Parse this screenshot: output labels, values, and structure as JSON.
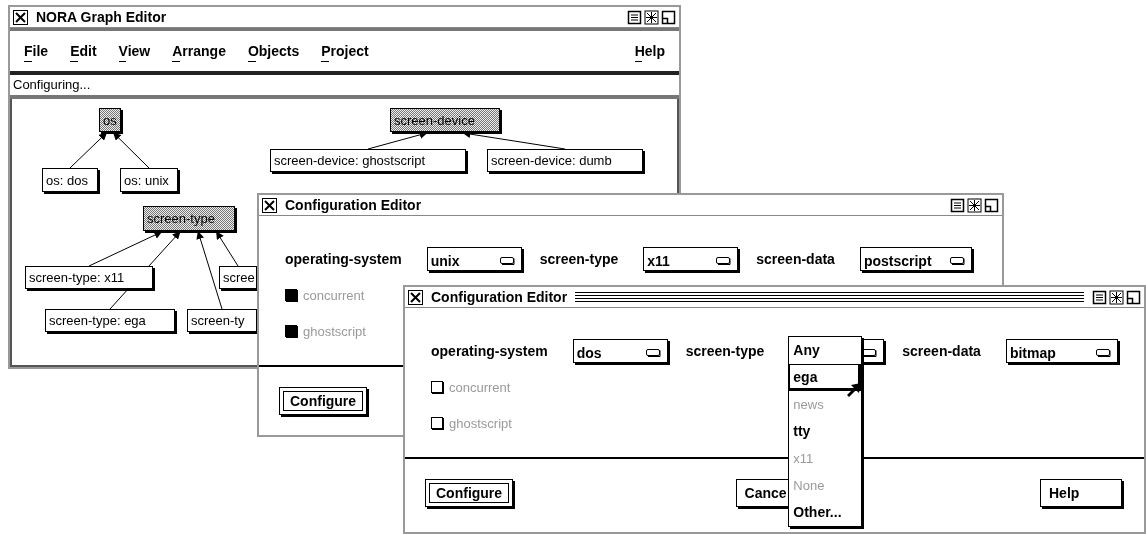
{
  "windows": [
    {
      "kind": "graph_editor",
      "title": "NORA Graph Editor",
      "active": false,
      "menus": [
        {
          "label": "File"
        },
        {
          "label": "Edit"
        },
        {
          "label": "View"
        },
        {
          "label": "Arrange"
        },
        {
          "label": "Objects"
        },
        {
          "label": "Project"
        }
      ],
      "help_menu": "Help",
      "status": "Configuring...",
      "graph": [
        {
          "label": "os",
          "kind": "class",
          "children": [
            {
              "label": "os: dos",
              "kind": "instance"
            },
            {
              "label": "os: unix",
              "kind": "instance"
            }
          ]
        },
        {
          "label": "screen-device",
          "kind": "class",
          "children": [
            {
              "label": "screen-device: ghostscript",
              "kind": "instance"
            },
            {
              "label": "screen-device: dumb",
              "kind": "instance"
            }
          ]
        },
        {
          "label": "screen-type",
          "kind": "class",
          "children": [
            {
              "label": "screen-type: x11",
              "kind": "instance"
            },
            {
              "label": "scree",
              "kind": "instance"
            },
            {
              "label": "screen-type: ega",
              "kind": "instance"
            },
            {
              "label": "screen-ty",
              "kind": "instance"
            }
          ]
        }
      ]
    },
    {
      "kind": "config_editor",
      "title": "Configuration Editor",
      "active": false,
      "fields": [
        {
          "label": "operating-system",
          "value": "unix",
          "expanded": false
        },
        {
          "label": "screen-type",
          "value": "x11",
          "expanded": false
        },
        {
          "label": "screen-data",
          "value": "postscript",
          "expanded": false
        }
      ],
      "options": [
        {
          "label": "concurrent",
          "checked": true,
          "disabled": true
        },
        {
          "label": "ghostscript",
          "checked": true,
          "disabled": true
        }
      ],
      "buttons": [
        {
          "label": "Configure",
          "default": true
        }
      ]
    },
    {
      "kind": "config_editor",
      "title": "Configuration Editor",
      "active": true,
      "fields": [
        {
          "label": "operating-system",
          "value": "dos",
          "expanded": false
        },
        {
          "label": "screen-type",
          "expanded": true,
          "menu": [
            {
              "label": "Any",
              "selected": false,
              "disabled": false
            },
            {
              "label": "ega",
              "selected": true,
              "disabled": false
            },
            {
              "label": "news",
              "selected": false,
              "disabled": true
            },
            {
              "label": "tty",
              "selected": false,
              "disabled": false
            },
            {
              "label": "x11",
              "selected": false,
              "disabled": true
            },
            {
              "label": "None",
              "selected": false,
              "disabled": true
            },
            {
              "label": "Other...",
              "selected": false,
              "disabled": false
            }
          ]
        },
        {
          "label": "screen-data",
          "value": "bitmap",
          "expanded": false
        }
      ],
      "options": [
        {
          "label": "concurrent",
          "checked": false,
          "disabled": true
        },
        {
          "label": "ghostscript",
          "checked": false,
          "disabled": true
        }
      ],
      "buttons": [
        {
          "label": "Configure",
          "default": true
        },
        {
          "label": "Cance",
          "default": false
        },
        {
          "label": "Help",
          "default": false
        }
      ]
    }
  ]
}
